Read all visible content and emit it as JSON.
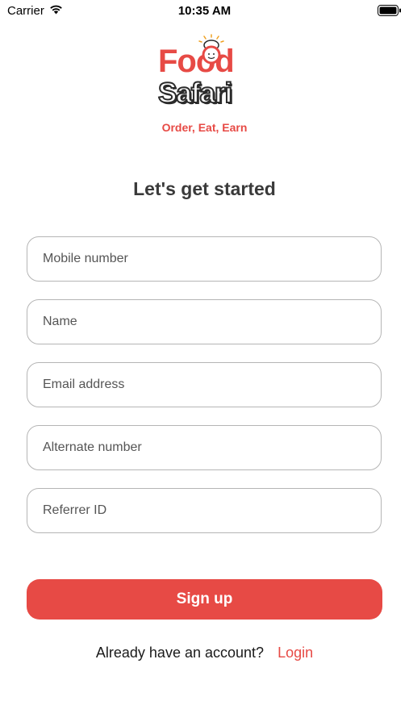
{
  "status_bar": {
    "carrier": "Carrier",
    "time": "10:35 AM"
  },
  "logo": {
    "food": "Food",
    "safari": "Safari",
    "tagline": "Order, Eat, Earn"
  },
  "heading": "Let's get started",
  "form": {
    "mobile": {
      "placeholder": "Mobile number",
      "value": ""
    },
    "name": {
      "placeholder": "Name",
      "value": ""
    },
    "email": {
      "placeholder": "Email address",
      "value": ""
    },
    "alternate": {
      "placeholder": "Alternate number",
      "value": ""
    },
    "referrer": {
      "placeholder": "Referrer ID",
      "value": ""
    }
  },
  "signup_button": "Sign up",
  "footer": {
    "prompt": "Already have an account?",
    "login": "Login"
  },
  "colors": {
    "accent": "#e74a45",
    "text": "#3a3a3a",
    "border": "#b5b5b5"
  },
  "icons": [
    "wifi-icon",
    "battery-icon",
    "chef-icon"
  ]
}
